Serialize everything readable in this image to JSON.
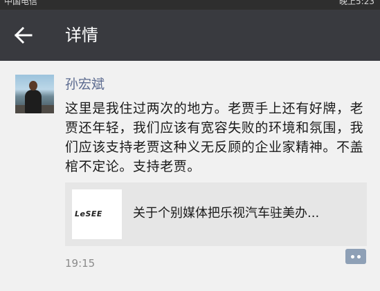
{
  "status_bar": {
    "left_text": "中国电信",
    "right_text": "晚上5:23"
  },
  "header": {
    "title": "详情"
  },
  "post": {
    "author": "孙宏斌",
    "text": "这里是我住过两次的地方。老贾手上还有好牌，老贾还年轻，我们应该有宽容失败的环境和氛围，我们应该支持老贾这种义无反顾的企业家精神。不盖棺不定论。支持老贾。",
    "link": {
      "thumb_logo_text": "LeSEE",
      "title": "关于个别媒体把乐视汽车驻美办..."
    },
    "time": "19:15"
  },
  "colors": {
    "app_bar": "#393a3f",
    "username": "#5b6a8f",
    "comment_button": "#8ea0b6"
  },
  "icons": [
    "back-arrow-icon",
    "comment-icon"
  ]
}
